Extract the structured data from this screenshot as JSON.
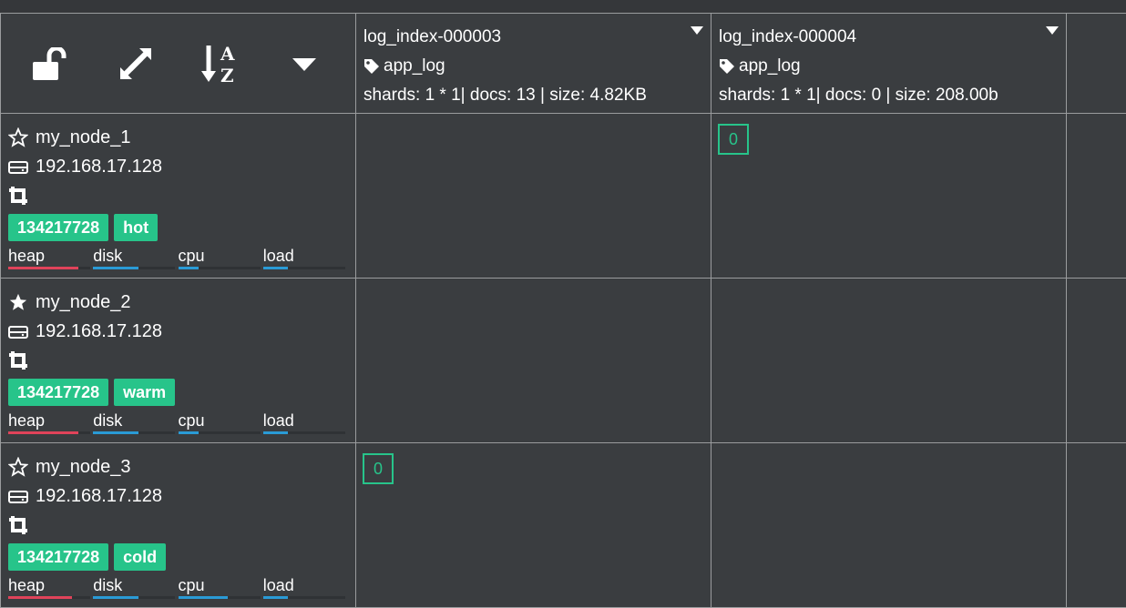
{
  "toolbar": {
    "lock_icon": "unlock-icon",
    "expand_icon": "expand-icon",
    "sort_icon": "sort-az-icon",
    "dropdown_icon": "caret-down-icon"
  },
  "indices": [
    {
      "name": "log_index-000003",
      "alias": "app_log",
      "info": "shards: 1 * 1| docs: 13 | size: 4.82KB"
    },
    {
      "name": "log_index-000004",
      "alias": "app_log",
      "info": "shards: 1 * 1| docs: 0 | size: 208.00b"
    }
  ],
  "nodes": [
    {
      "name": "my_node_1",
      "star": "star-outline-icon",
      "ip": "192.168.17.128",
      "id": "134217728",
      "tier": "hot",
      "stats": {
        "heap": 0.85,
        "disk": 0.55,
        "cpu": 0.25,
        "load": 0.3
      }
    },
    {
      "name": "my_node_2",
      "star": "star-filled-icon",
      "ip": "192.168.17.128",
      "id": "134217728",
      "tier": "warm",
      "stats": {
        "heap": 0.85,
        "disk": 0.55,
        "cpu": 0.25,
        "load": 0.3
      }
    },
    {
      "name": "my_node_3",
      "star": "star-outline-icon",
      "ip": "192.168.17.128",
      "id": "134217728",
      "tier": "cold",
      "stats": {
        "heap": 0.78,
        "disk": 0.55,
        "cpu": 0.6,
        "load": 0.3
      }
    }
  ],
  "stat_labels": {
    "heap": "heap",
    "disk": "disk",
    "cpu": "cpu",
    "load": "load"
  },
  "shards": {
    "node1_index4": "0",
    "node3_index3": "0"
  },
  "colors": {
    "heap": "#e0435a",
    "disk": "#2a9bd6",
    "cpu": "#2a9bd6",
    "load": "#2a9bd6",
    "accent": "#27c48a"
  }
}
